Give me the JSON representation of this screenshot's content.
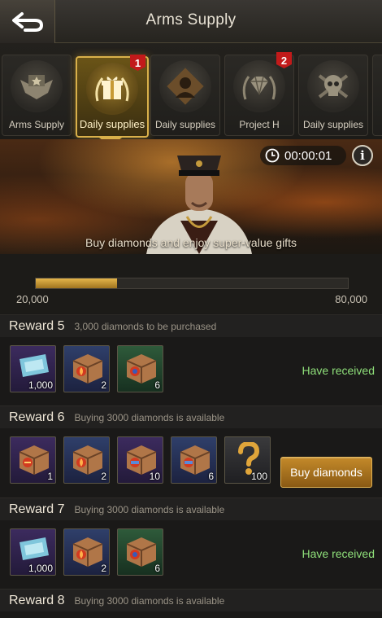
{
  "header": {
    "title": "Arms Supply",
    "back_icon": "back-arrow-icon"
  },
  "tabs": [
    {
      "label": "Arms Supply",
      "icon": "eagle-emblem-icon",
      "active": false,
      "badge": ""
    },
    {
      "label": "Daily supplies",
      "icon": "gift-box-emblem-icon",
      "active": true,
      "badge": "1"
    },
    {
      "label": "Daily supplies",
      "icon": "soldier-emblem-icon",
      "active": false,
      "badge": ""
    },
    {
      "label": "Project H",
      "icon": "diamond-emblem-icon",
      "active": false,
      "badge": "2"
    },
    {
      "label": "Daily supplies",
      "icon": "skull-emblem-icon",
      "active": false,
      "badge": ""
    }
  ],
  "banner": {
    "timer": "00:00:01",
    "info": "i",
    "caption": "Buy diamonds and enjoy super-value gifts",
    "accent": "#d9b04a"
  },
  "progress": {
    "min": "20,000",
    "max": "80,000",
    "fraction": 0.26
  },
  "rewards": [
    {
      "title": "Reward 5",
      "desc": "3,000 diamonds to be purchased",
      "status": "Have received",
      "items": [
        {
          "kind": "blue-ticket",
          "rarity": "purple",
          "qty": "1,000"
        },
        {
          "kind": "crate-flame",
          "rarity": "blue",
          "qty": "2"
        },
        {
          "kind": "crate-red",
          "rarity": "green",
          "qty": "6"
        }
      ]
    },
    {
      "title": "Reward 6",
      "desc": "Buying 3000 diamonds is available",
      "button": "Buy diamonds",
      "items": [
        {
          "kind": "crate-red",
          "rarity": "purple",
          "qty": "1"
        },
        {
          "kind": "crate-flame",
          "rarity": "blue",
          "qty": "2"
        },
        {
          "kind": "crate-blue",
          "rarity": "purple",
          "qty": "10"
        },
        {
          "kind": "crate-blue",
          "rarity": "blue",
          "qty": "6"
        },
        {
          "kind": "mystery",
          "rarity": "dark",
          "qty": "100"
        }
      ]
    },
    {
      "title": "Reward 7",
      "desc": "Buying 3000 diamonds is available",
      "status": "Have received",
      "items": [
        {
          "kind": "blue-ticket",
          "rarity": "purple",
          "qty": "1,000"
        },
        {
          "kind": "crate-flame",
          "rarity": "blue",
          "qty": "2"
        },
        {
          "kind": "crate-red",
          "rarity": "green",
          "qty": "6"
        }
      ]
    },
    {
      "title": "Reward 8",
      "desc": "Buying 3000 diamonds is available"
    }
  ],
  "colors": {
    "received": "#8fe07a",
    "badge": "#c21a1a",
    "progress": "#e4b54a"
  }
}
